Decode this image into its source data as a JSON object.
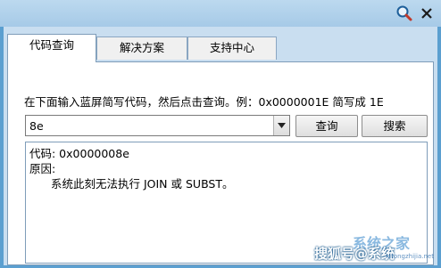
{
  "titlebar": {
    "search_icon": "magnifier-icon",
    "close_icon": "close-icon"
  },
  "tabs": [
    {
      "label": "代码查询",
      "active": true
    },
    {
      "label": "解决方案",
      "active": false
    },
    {
      "label": "支持中心",
      "active": false
    }
  ],
  "main": {
    "instruction": "在下面输入蓝屏简写代码，然后点击查询。例：0x0000001E 简写成 1E",
    "code_input_value": "8e",
    "query_button": "查询",
    "search_button": "搜索",
    "result": {
      "code_line": "代码: 0x0000008e",
      "reason_label": "原因:",
      "reason_text": "系统此刻无法执行 JOIN 或 SUBST。"
    }
  },
  "watermark": {
    "text": "搜狐号@系统",
    "brand": "系统之家",
    "url": "xitongzhijia.net"
  },
  "colors": {
    "frame_blue": "#5b9fd0",
    "client_bg": "#c9def0",
    "panel_border": "#7f9db9"
  }
}
